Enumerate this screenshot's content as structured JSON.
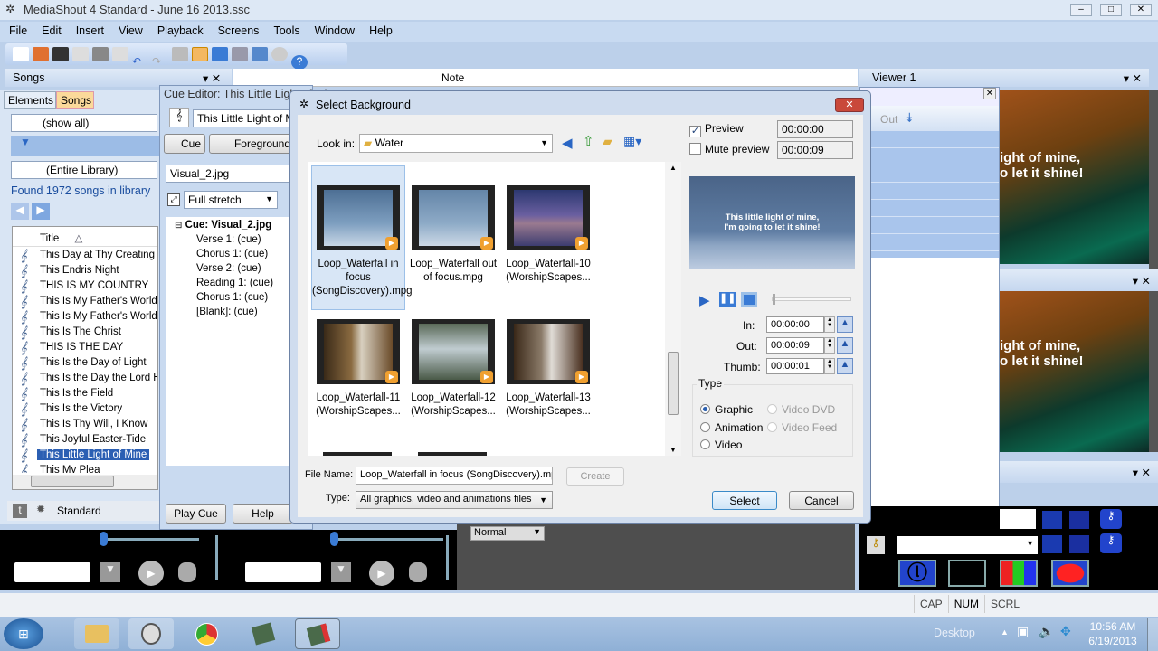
{
  "app": {
    "title": "MediaShout 4 Standard - June 16 2013.ssc"
  },
  "menu": [
    "File",
    "Edit",
    "Insert",
    "View",
    "Playback",
    "Screens",
    "Tools",
    "Window",
    "Help"
  ],
  "songs_panel": {
    "title": "Songs",
    "tabs": [
      "Elements",
      "Songs"
    ],
    "filter": "(show all)",
    "library": "(Entire Library)",
    "found": "Found 1972 songs in library",
    "column_title": "Title",
    "rows": [
      "This Day at Thy Creating ...",
      "This Endris Night",
      "THIS IS MY COUNTRY",
      "This Is My Father's World",
      "This Is My Father's World",
      "This Is The Christ",
      "THIS IS THE DAY",
      "This Is the Day of Light",
      "This Is the Day the Lord H...",
      "This Is the Field",
      "This Is the Victory",
      "This Is Thy Will, I Know",
      "This Joyful Easter-Tide",
      "This Little Light of Mine",
      "This My Plea"
    ],
    "selected_index": 13,
    "style": "Standard"
  },
  "note_header": "Note",
  "cue_editor": {
    "title": "Cue Editor: This Little Light of Mine",
    "name": "This Little Light of Mine",
    "tabs": [
      "Cue",
      "Foreground"
    ],
    "background_file": "Visual_2.jpg",
    "stretch": "Full stretch",
    "tree_root": "Cue: Visual_2.jpg",
    "tree_items": [
      "Verse 1: (cue)",
      "Chorus 1: (cue)",
      "Verse 2: (cue)",
      "Reading 1: (cue)",
      "Chorus 1: (cue)",
      "[Blank]: (cue)"
    ],
    "play_cue": "Play Cue",
    "help": "Help"
  },
  "dialog": {
    "title": "Select Background",
    "look_in_label": "Look in:",
    "look_in": "Water",
    "files": [
      {
        "name": "Loop_Waterfall in focus (SongDiscovery).mpg",
        "selected": true
      },
      {
        "name": "Loop_Waterfall out of focus.mpg"
      },
      {
        "name": "Loop_Waterfall-10 (WorshipScapes..."
      },
      {
        "name": "Loop_Waterfall-11 (WorshipScapes..."
      },
      {
        "name": "Loop_Waterfall-12 (WorshipScapes..."
      },
      {
        "name": "Loop_Waterfall-13 (WorshipScapes..."
      }
    ],
    "preview_label": "Preview",
    "preview_checked": true,
    "mute_label": "Mute preview",
    "mute_checked": false,
    "time_start": "00:00:00",
    "time_end": "00:00:09",
    "preview_lyrics": [
      "This little light of mine,",
      "I'm going to let it shine!"
    ],
    "in_label": "In:",
    "in": "00:00:00",
    "out_label": "Out:",
    "out": "00:00:09",
    "thumb_label": "Thumb:",
    "thumb": "00:00:01",
    "type_label": "Type",
    "types": [
      {
        "label": "Graphic",
        "selected": true
      },
      {
        "label": "Video DVD",
        "disabled": true
      },
      {
        "label": "Animation"
      },
      {
        "label": "Video Feed",
        "disabled": true
      },
      {
        "label": "Video"
      }
    ],
    "file_name_label": "File Name:",
    "file_name": "Loop_Waterfall in focus (SongDiscovery).mpg",
    "create": "Create",
    "type_field_label": "Type:",
    "type_value": "All graphics, video and animations files",
    "select": "Select",
    "cancel": "Cancel"
  },
  "viewer": {
    "title": "Viewer 1",
    "out_label": "Out",
    "lyrics": [
      "ight of mine,",
      "o let it shine!"
    ]
  },
  "bottom": {
    "blend": "Normal"
  },
  "status": [
    "CAP",
    "NUM",
    "SCRL"
  ],
  "taskbar": {
    "desktop": "Desktop",
    "time": "10:56 AM",
    "date": "6/19/2013"
  },
  "colors": {
    "selection": "#2b5fb3",
    "accent": "#c8daf1"
  }
}
